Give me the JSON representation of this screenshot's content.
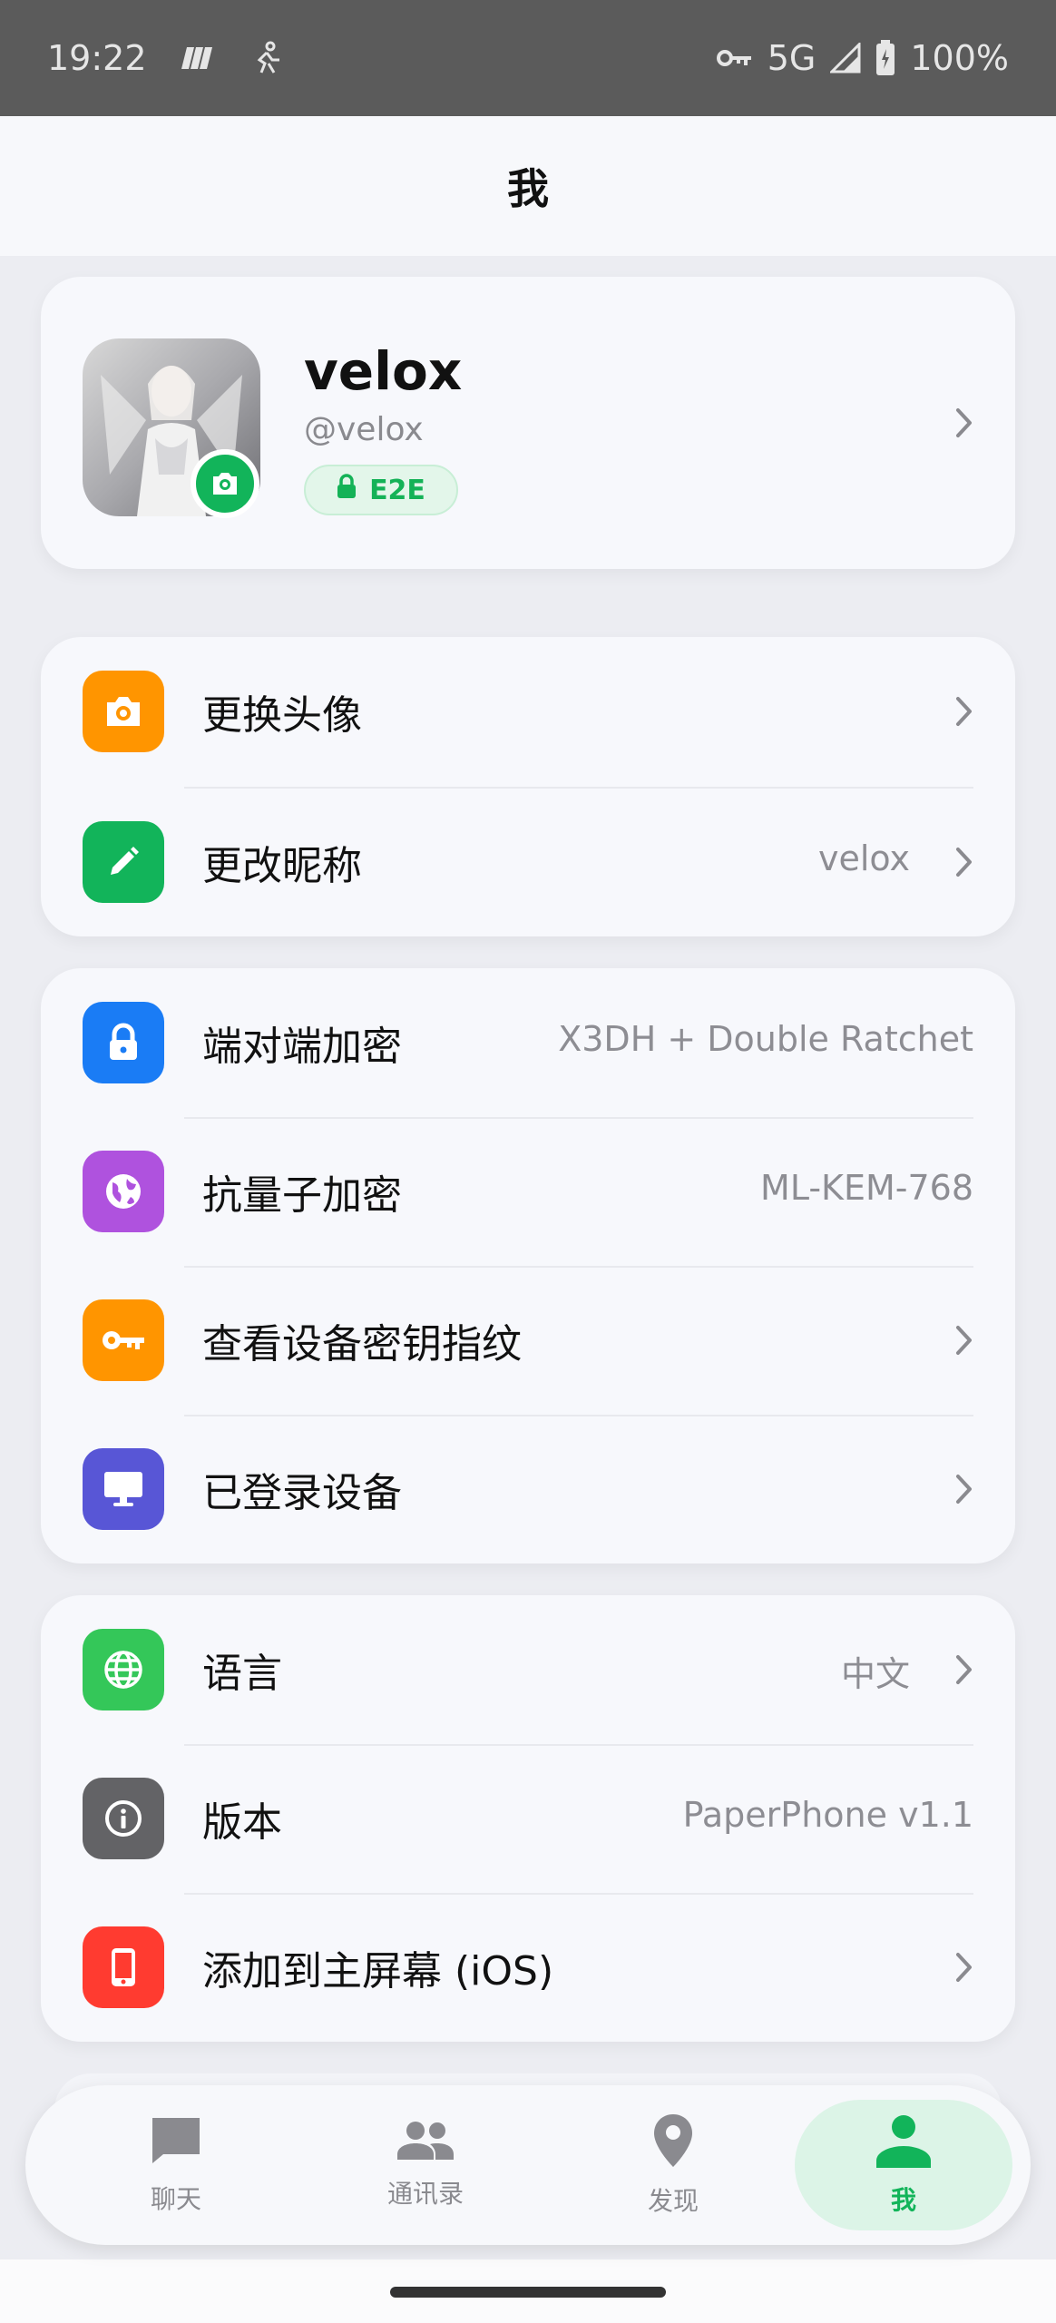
{
  "status_bar": {
    "time": "19:22",
    "network": "5G",
    "battery": "100%"
  },
  "header": {
    "title": "我"
  },
  "profile": {
    "name": "velox",
    "handle": "@velox",
    "badge": "E2E"
  },
  "group1": [
    {
      "label": "更换头像",
      "value": "",
      "icon": "camera-icon",
      "color": "#ff9500",
      "chevron": true
    },
    {
      "label": "更改昵称",
      "value": "velox",
      "icon": "pencil-icon",
      "color": "#12b45a",
      "chevron": true
    }
  ],
  "group2": [
    {
      "label": "端对端加密",
      "value": "X3DH + Double Ratchet",
      "icon": "lock-icon",
      "color": "#1a7cf5",
      "chevron": false
    },
    {
      "label": "抗量子加密",
      "value": "ML-KEM-768",
      "icon": "globe-icon",
      "color": "#af52de",
      "chevron": false
    },
    {
      "label": "查看设备密钥指纹",
      "value": "",
      "icon": "key-icon",
      "color": "#ff9500",
      "chevron": true
    },
    {
      "label": "已登录设备",
      "value": "",
      "icon": "monitor-icon",
      "color": "#5856d6",
      "chevron": true
    }
  ],
  "group3": [
    {
      "label": "语言",
      "value": "中文",
      "icon": "language-globe-icon",
      "color": "#34c759",
      "chevron": true
    },
    {
      "label": "版本",
      "value": "PaperPhone v1.1",
      "icon": "info-icon",
      "color": "#636366",
      "chevron": false
    },
    {
      "label": "添加到主屏幕 (iOS)",
      "value": "",
      "icon": "phone-icon",
      "color": "#ff3b30",
      "chevron": true
    }
  ],
  "bottom_nav": [
    {
      "label": "聊天",
      "icon": "chat-icon",
      "active": false
    },
    {
      "label": "通讯录",
      "icon": "contacts-icon",
      "active": false
    },
    {
      "label": "发现",
      "icon": "location-pin-icon",
      "active": false
    },
    {
      "label": "我",
      "icon": "person-icon",
      "active": true
    }
  ],
  "colors": {
    "accent": "#12b45a"
  }
}
